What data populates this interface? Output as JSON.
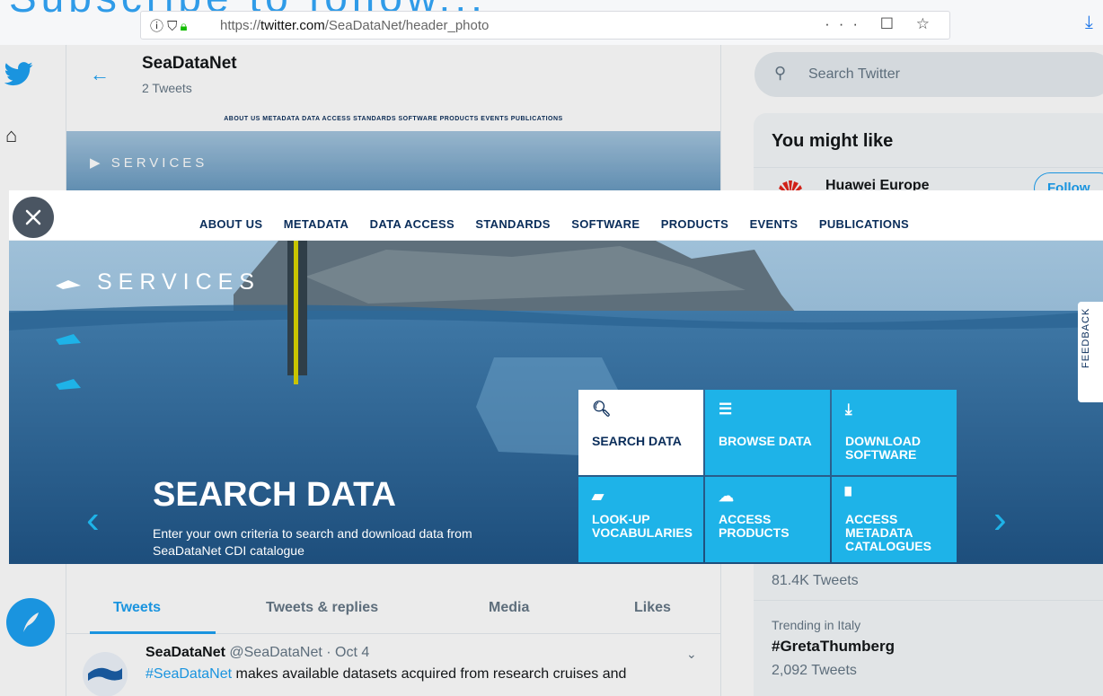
{
  "cut_heading": "Subscribe to follow...",
  "browser": {
    "url_prefix": "https://",
    "url_domain": "twitter.com",
    "url_path": "/SeaDataNet/header_photo",
    "actions": "··· ☐ ☆"
  },
  "twitter": {
    "profile_name": "SeaDataNet",
    "tweet_count": "2 Tweets",
    "mini_nav": "ABOUT US   METADATA   DATA ACCESS   STANDARDS   SOFTWARE   PRODUCTS   EVENTS   PUBLICATIONS",
    "mini_services": "SERVICES",
    "tabs": [
      "Tweets",
      "Tweets & replies",
      "Media",
      "Likes"
    ],
    "tweet": {
      "name": "SeaDataNet",
      "handle": "@SeaDataNet · Oct 4",
      "hashtag": "#SeaDataNet",
      "text": " makes available datasets acquired from research cruises and"
    },
    "search_placeholder": "Search Twitter",
    "might_like_title": "You might like",
    "suggestion_name": "Huawei Europe",
    "follow_label": "Follow",
    "trend_prev_count": "81.4K Tweets",
    "trend_label": "Trending in Italy",
    "trend_tag": "#GretaThumberg",
    "trend_count": "2,092 Tweets"
  },
  "photo": {
    "nav_items": [
      "ABOUT US",
      "METADATA",
      "DATA ACCESS",
      "STANDARDS",
      "SOFTWARE",
      "PRODUCTS",
      "EVENTS",
      "PUBLICATIONS"
    ],
    "services_label": "SERVICES",
    "heading": "SEARCH DATA",
    "description_line1": "Enter your own criteria to search and download data from",
    "description_line2": "SeaDataNet CDI catalogue",
    "feedback_label": "FEEDBACK",
    "tiles": [
      {
        "icon": "search-icon",
        "glyph": "🔍︎",
        "label": "SEARCH DATA"
      },
      {
        "icon": "list-icon",
        "glyph": "☰",
        "label": "BROWSE DATA"
      },
      {
        "icon": "download-icon",
        "glyph": "⤓",
        "label": "DOWNLOAD SOFTWARE"
      },
      {
        "icon": "book-icon",
        "glyph": "▰",
        "label": "LOOK-UP VOCABULARIES"
      },
      {
        "icon": "cloud-icon",
        "glyph": "☁",
        "label": "ACCESS PRODUCTS"
      },
      {
        "icon": "document-icon",
        "glyph": "▘",
        "label": "ACCESS METADATA CATALOGUES"
      }
    ]
  },
  "colors": {
    "twitter_blue": "#1da1f2",
    "tile_blue": "#1eb3e8",
    "nav_navy": "#0a2d5a"
  }
}
